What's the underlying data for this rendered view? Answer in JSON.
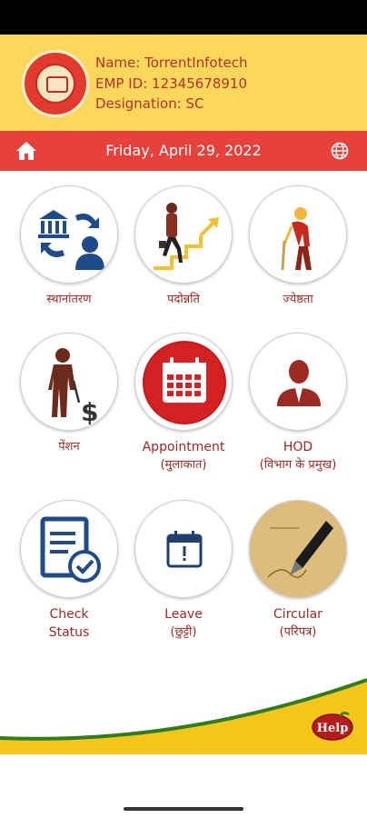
{
  "profile": {
    "name_line": "Name: TorrentInfotech",
    "emp_line": "EMP ID: 12345678910",
    "designation_line": "Designation: SC"
  },
  "date_bar": {
    "date": "Friday, April 29, 2022"
  },
  "tiles": [
    {
      "icon": "transfer-icon",
      "label": "स्थानांतरण"
    },
    {
      "icon": "promotion-icon",
      "label": "पदोन्नति"
    },
    {
      "icon": "seniority-icon",
      "label": "ज्येष्ठता"
    },
    {
      "icon": "pension-icon",
      "label": "पेंशन"
    },
    {
      "icon": "appointment-calendar-icon",
      "label": "Appointment",
      "sublabel": "(मुलाकात)"
    },
    {
      "icon": "hod-person-icon",
      "label": "HOD",
      "sublabel": "(विभाग के प्रमुख)"
    },
    {
      "icon": "check-status-icon",
      "label": "Check",
      "sublabel": "Status"
    },
    {
      "icon": "leave-calendar-icon",
      "label": "Leave",
      "sublabel": "(छुट्टी)"
    },
    {
      "icon": "circular-pen-icon",
      "label": "Circular",
      "sublabel": "(परिपत्र)"
    }
  ],
  "help": {
    "label": "Help"
  },
  "colors": {
    "header_yellow": "#fbd75b",
    "date_bar_red": "#e8413c",
    "label_red": "#9c2a23",
    "wave_green": "#2e7d1e"
  }
}
